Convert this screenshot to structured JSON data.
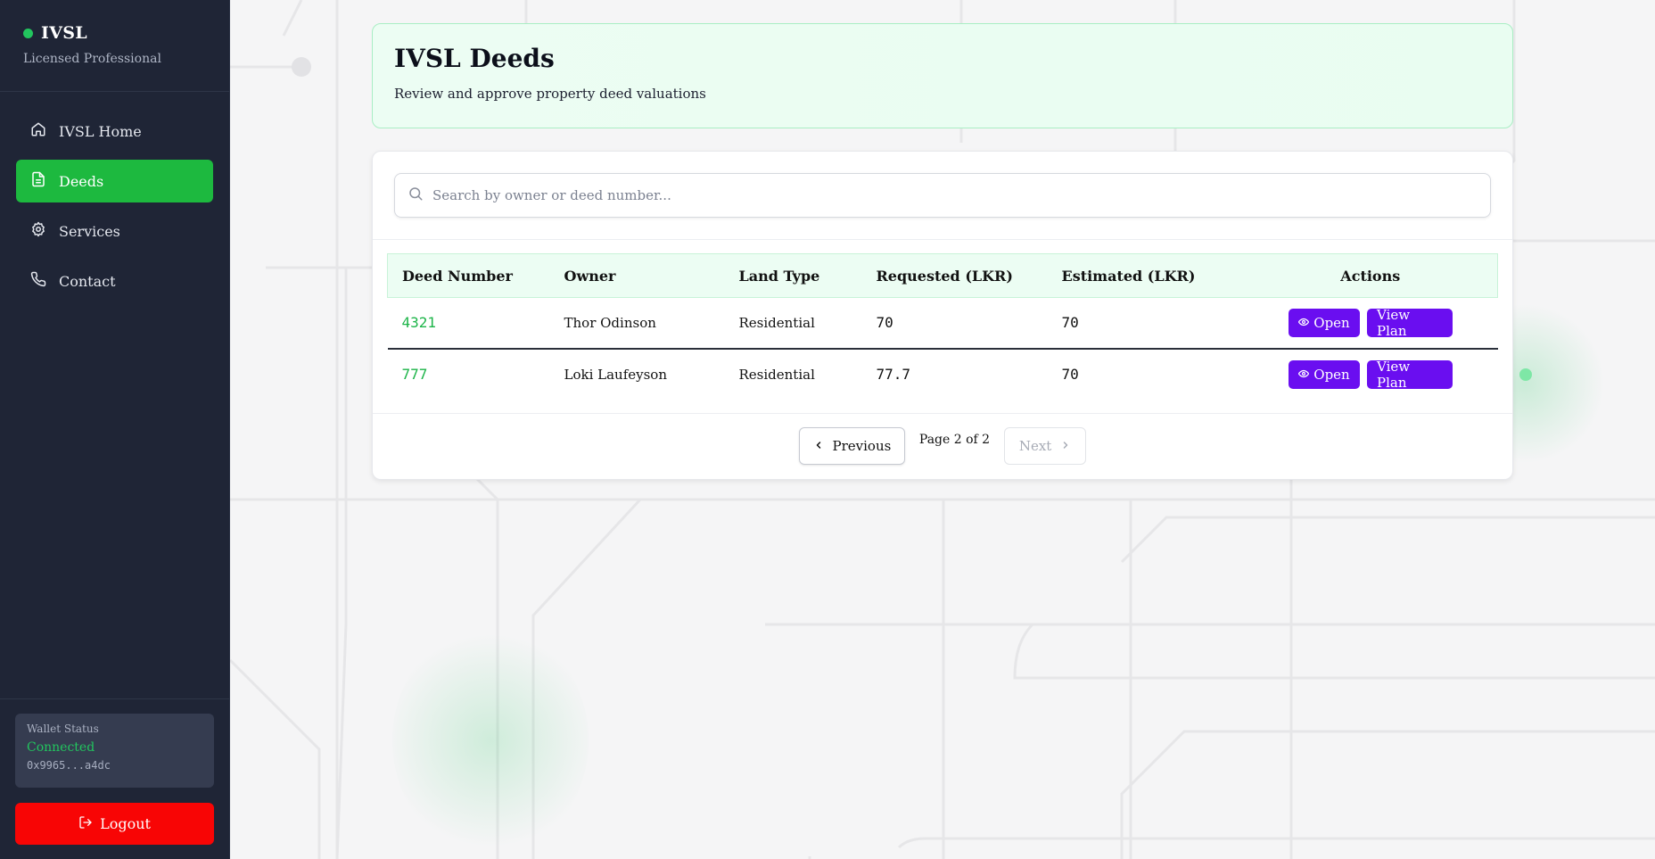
{
  "sidebar": {
    "brand_name": "IVSL",
    "brand_sub": "Licensed Professional",
    "items": [
      {
        "label": "IVSL Home",
        "icon": "home-icon"
      },
      {
        "label": "Deeds",
        "icon": "document-icon",
        "active": true
      },
      {
        "label": "Services",
        "icon": "gear-icon"
      },
      {
        "label": "Contact",
        "icon": "phone-icon"
      }
    ],
    "wallet": {
      "label": "Wallet Status",
      "status": "Connected",
      "address": "0x9965...a4dc"
    },
    "logout_label": "Logout"
  },
  "header": {
    "title": "IVSL Deeds",
    "subtitle": "Review and approve property deed valuations"
  },
  "search": {
    "placeholder": "Search by owner or deed number..."
  },
  "table": {
    "columns": [
      "Deed Number",
      "Owner",
      "Land Type",
      "Requested (LKR)",
      "Estimated (LKR)",
      "Actions"
    ],
    "rows": [
      {
        "deed": "4321",
        "owner": "Thor Odinson",
        "land_type": "Residential",
        "requested": "70",
        "estimated": "70"
      },
      {
        "deed": "777",
        "owner": "Loki Laufeyson",
        "land_type": "Residential",
        "requested": "77.7",
        "estimated": "70"
      }
    ],
    "open_label": "Open",
    "plan_label": "View Plan"
  },
  "pagination": {
    "prev_label": "Previous",
    "info": "Page 2 of 2",
    "next_label": "Next"
  },
  "colors": {
    "accent_green": "#1db93f",
    "action_purple": "#6a0ef0",
    "logout_red": "#f80505",
    "sidebar_bg": "#1f2536"
  }
}
